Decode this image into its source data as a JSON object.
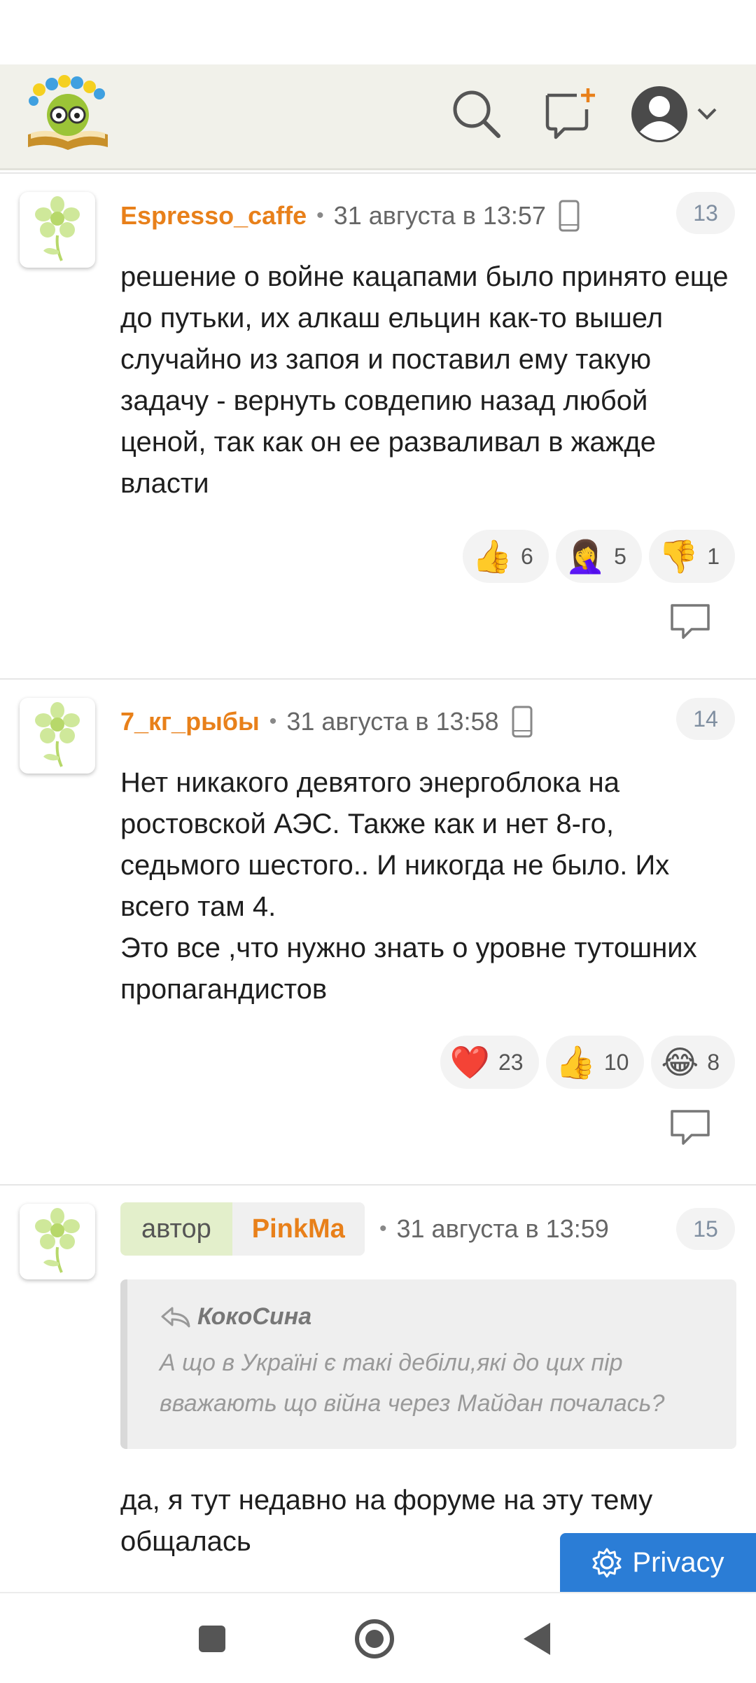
{
  "header": {
    "logo": "forum-logo",
    "icons": [
      "search-icon",
      "new-post-icon",
      "user-avatar-icon",
      "chevron-down-icon"
    ]
  },
  "comments": [
    {
      "username": "Espresso_caffe",
      "time": "31 августа в 13:57",
      "number": "13",
      "text": "решение о войне кацапами было принято еще до путьки, их алкаш ельцин как-то вышел случайно из запоя и поставил ему такую задачу - вернуть совдепию назад любой ценой, так как он ее разваливал в жажде власти",
      "reactions": [
        {
          "emoji": "👍",
          "count": "6"
        },
        {
          "emoji": "🤦‍♀️",
          "count": "5"
        },
        {
          "emoji": "👎",
          "count": "1"
        }
      ]
    },
    {
      "username": "7_кг_рыбы",
      "time": "31 августа в 13:58",
      "number": "14",
      "text": "Нет никакого девятого энергоблока на ростовской АЭС. Также как и нет 8-го, седьмого шестого.. И никогда не было. Их всего там 4.\nЭто все ,что нужно знать о уровне тутошних пропагандистов",
      "reactions": [
        {
          "emoji": "❤️",
          "count": "23"
        },
        {
          "emoji": "👍",
          "count": "10"
        },
        {
          "emoji": "😂",
          "count": "8"
        }
      ]
    },
    {
      "author_label": "автор",
      "username": "PinkMa",
      "time": "31 августа в 13:59",
      "number": "15",
      "quote": {
        "author": "КокоСина",
        "text": "А що в Україні є такі дебіли,які до цих пір вважають що війна через Майдан почалась?"
      },
      "text": "да, я тут недавно на форуме на эту тему общалась"
    }
  ],
  "privacy": {
    "label": "Privacy",
    "icon": "gear-icon"
  },
  "nav": [
    "recents-button",
    "home-button",
    "back-button"
  ],
  "colors": {
    "username": "#e8801a",
    "header_bg": "#f1f1ea",
    "privacy_bg": "#2b7dd6"
  }
}
